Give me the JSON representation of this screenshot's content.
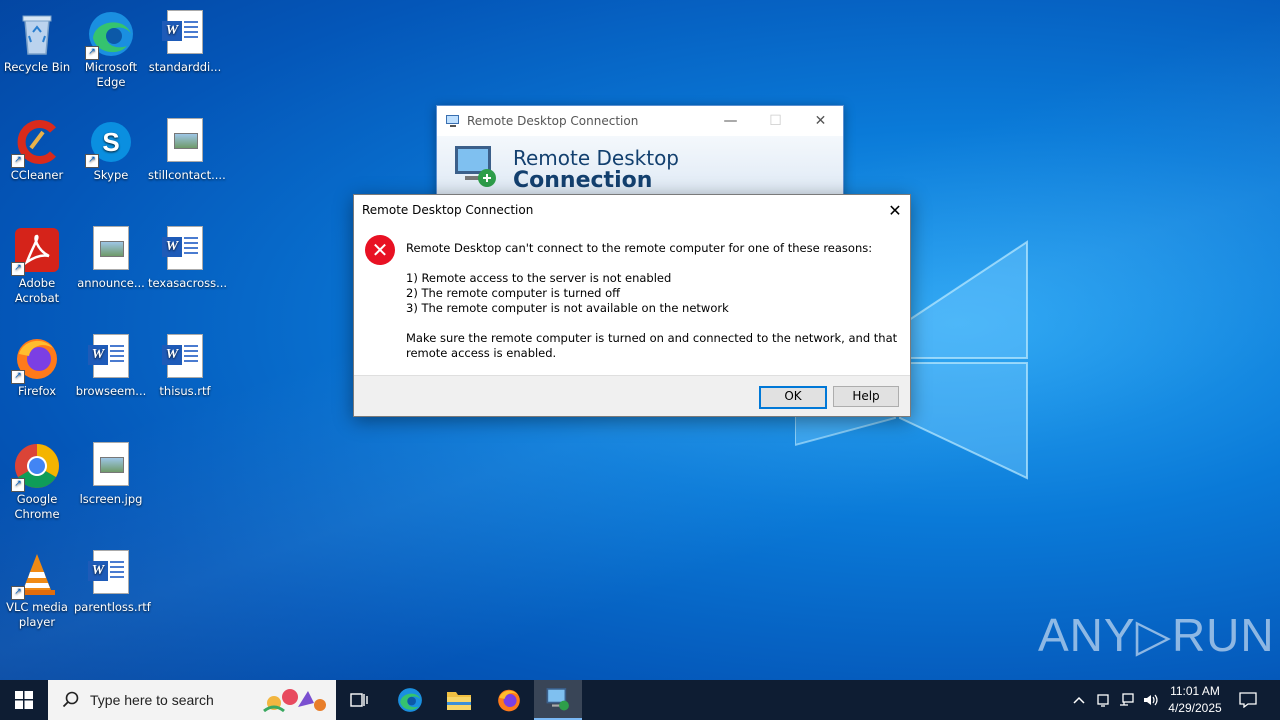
{
  "desktop": {
    "icons": [
      {
        "label": "Recycle Bin",
        "icon": "recycle-bin-icon"
      },
      {
        "label": "Microsoft Edge",
        "icon": "edge-icon"
      },
      {
        "label": "standarddi...",
        "icon": "word-document-icon"
      },
      {
        "label": "CCleaner",
        "icon": "ccleaner-icon"
      },
      {
        "label": "Skype",
        "icon": "skype-icon"
      },
      {
        "label": "stillcontact....",
        "icon": "image-file-icon"
      },
      {
        "label": "Adobe Acrobat",
        "icon": "acrobat-icon"
      },
      {
        "label": "announce...",
        "icon": "image-file-icon"
      },
      {
        "label": "texasacross...",
        "icon": "word-document-icon"
      },
      {
        "label": "Firefox",
        "icon": "firefox-icon"
      },
      {
        "label": "browseem...",
        "icon": "word-document-icon"
      },
      {
        "label": "thisus.rtf",
        "icon": "word-document-icon"
      },
      {
        "label": "Google Chrome",
        "icon": "chrome-icon"
      },
      {
        "label": "lscreen.jpg",
        "icon": "image-file-icon"
      },
      {
        "label": "VLC media player",
        "icon": "vlc-icon"
      },
      {
        "label": "parentloss.rtf",
        "icon": "word-document-icon"
      }
    ]
  },
  "rdc_window": {
    "title": "Remote Desktop Connection",
    "banner_line1": "Remote Desktop",
    "banner_line2": "Connection",
    "minimize": "—",
    "maximize": "☐",
    "close": "✕"
  },
  "error_dialog": {
    "title": "Remote Desktop Connection",
    "close": "✕",
    "icon": "error-icon",
    "message_intro": "Remote Desktop can't connect to the remote computer for one of these reasons:",
    "reasons": [
      "1) Remote access to the server is not enabled",
      "2) The remote computer is turned off",
      "3) The remote computer is not available on the network"
    ],
    "message_footer": "Make sure the remote computer is turned on and connected to the network, and that remote access is enabled.",
    "ok_label": "OK",
    "help_label": "Help"
  },
  "taskbar": {
    "search_placeholder": "Type here to search",
    "time": "11:01 AM",
    "date": "4/29/2025"
  },
  "watermark": "ANY▷RUN",
  "colors": {
    "desktop_bg": "#0a7ad8",
    "error_red": "#e81123",
    "taskbar_bg": "#0e1d33"
  }
}
